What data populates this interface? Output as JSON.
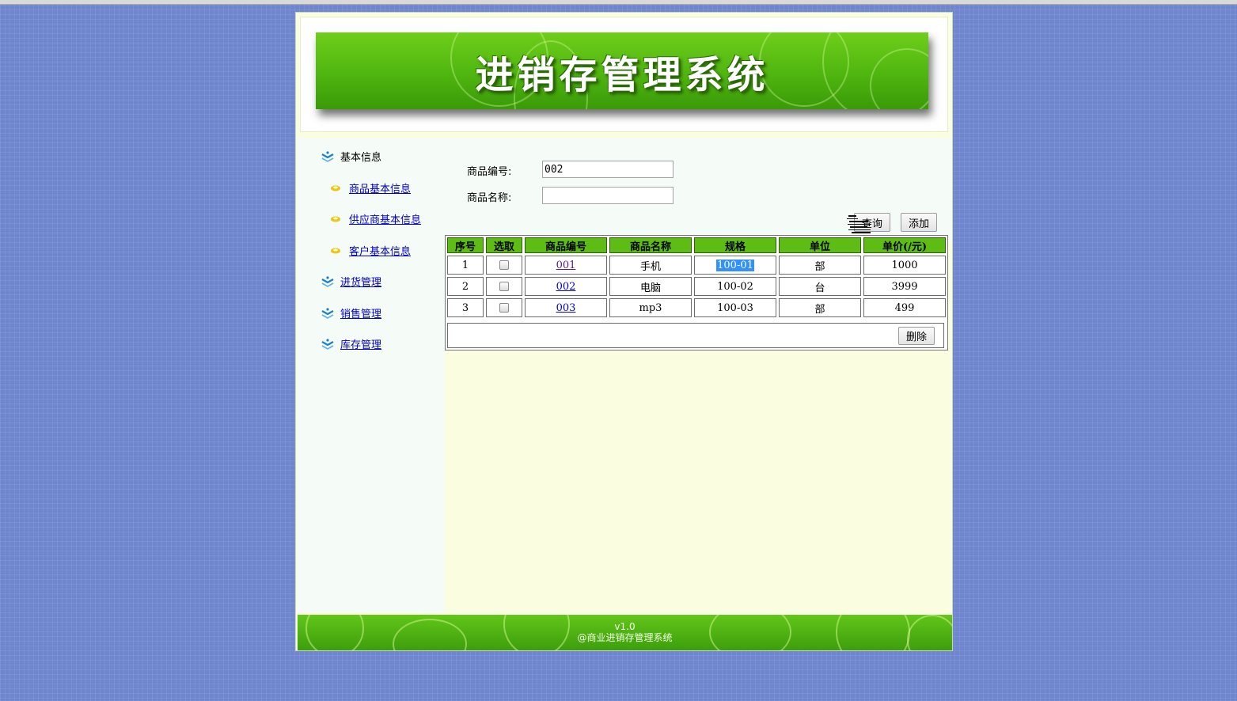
{
  "app": {
    "banner_title": "进销存管理系统"
  },
  "sidebar": {
    "section_basic": "基本信息",
    "items": [
      {
        "label": "商品基本信息"
      },
      {
        "label": "供应商基本信息"
      },
      {
        "label": "客户基本信息"
      }
    ],
    "purchase": "进货管理",
    "sales": "销售管理",
    "inventory": "库存管理"
  },
  "search": {
    "code_label": "商品编号:",
    "code_value": "002",
    "name_label": "商品名称:",
    "name_value": "",
    "query_button": "查询",
    "add_button": "添加"
  },
  "table": {
    "headers": [
      "序号",
      "选取",
      "商品编号",
      "商品名称",
      "规格",
      "单位",
      "单价(/元)"
    ],
    "rows": [
      {
        "index": "1",
        "code": "001",
        "name": "手机",
        "spec": "100-01",
        "unit": "部",
        "price": "1000"
      },
      {
        "index": "2",
        "code": "002",
        "name": "电脑",
        "spec": "100-02",
        "unit": "台",
        "price": "3999"
      },
      {
        "index": "3",
        "code": "003",
        "name": "mp3",
        "spec": "100-03",
        "unit": "部",
        "price": "499"
      }
    ],
    "delete_button": "删除"
  },
  "footer": {
    "version": "v1.0",
    "copyright": "@商业进销存管理系统"
  },
  "colors": {
    "page_bg": "#6f86cf",
    "banner_green": "#4fb50f",
    "header_green": "#5dbd15",
    "content_bg": "#fbfde0",
    "link": "#0000cc"
  }
}
